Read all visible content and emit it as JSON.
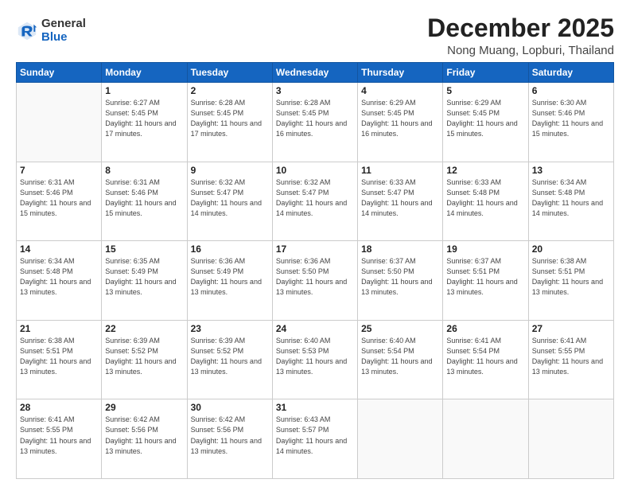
{
  "logo": {
    "general": "General",
    "blue": "Blue"
  },
  "header": {
    "month": "December 2025",
    "location": "Nong Muang, Lopburi, Thailand"
  },
  "weekdays": [
    "Sunday",
    "Monday",
    "Tuesday",
    "Wednesday",
    "Thursday",
    "Friday",
    "Saturday"
  ],
  "weeks": [
    [
      {
        "day": "",
        "sunrise": "",
        "sunset": "",
        "daylight": ""
      },
      {
        "day": "1",
        "sunrise": "Sunrise: 6:27 AM",
        "sunset": "Sunset: 5:45 PM",
        "daylight": "Daylight: 11 hours and 17 minutes."
      },
      {
        "day": "2",
        "sunrise": "Sunrise: 6:28 AM",
        "sunset": "Sunset: 5:45 PM",
        "daylight": "Daylight: 11 hours and 17 minutes."
      },
      {
        "day": "3",
        "sunrise": "Sunrise: 6:28 AM",
        "sunset": "Sunset: 5:45 PM",
        "daylight": "Daylight: 11 hours and 16 minutes."
      },
      {
        "day": "4",
        "sunrise": "Sunrise: 6:29 AM",
        "sunset": "Sunset: 5:45 PM",
        "daylight": "Daylight: 11 hours and 16 minutes."
      },
      {
        "day": "5",
        "sunrise": "Sunrise: 6:29 AM",
        "sunset": "Sunset: 5:45 PM",
        "daylight": "Daylight: 11 hours and 15 minutes."
      },
      {
        "day": "6",
        "sunrise": "Sunrise: 6:30 AM",
        "sunset": "Sunset: 5:46 PM",
        "daylight": "Daylight: 11 hours and 15 minutes."
      }
    ],
    [
      {
        "day": "7",
        "sunrise": "Sunrise: 6:31 AM",
        "sunset": "Sunset: 5:46 PM",
        "daylight": "Daylight: 11 hours and 15 minutes."
      },
      {
        "day": "8",
        "sunrise": "Sunrise: 6:31 AM",
        "sunset": "Sunset: 5:46 PM",
        "daylight": "Daylight: 11 hours and 15 minutes."
      },
      {
        "day": "9",
        "sunrise": "Sunrise: 6:32 AM",
        "sunset": "Sunset: 5:47 PM",
        "daylight": "Daylight: 11 hours and 14 minutes."
      },
      {
        "day": "10",
        "sunrise": "Sunrise: 6:32 AM",
        "sunset": "Sunset: 5:47 PM",
        "daylight": "Daylight: 11 hours and 14 minutes."
      },
      {
        "day": "11",
        "sunrise": "Sunrise: 6:33 AM",
        "sunset": "Sunset: 5:47 PM",
        "daylight": "Daylight: 11 hours and 14 minutes."
      },
      {
        "day": "12",
        "sunrise": "Sunrise: 6:33 AM",
        "sunset": "Sunset: 5:48 PM",
        "daylight": "Daylight: 11 hours and 14 minutes."
      },
      {
        "day": "13",
        "sunrise": "Sunrise: 6:34 AM",
        "sunset": "Sunset: 5:48 PM",
        "daylight": "Daylight: 11 hours and 14 minutes."
      }
    ],
    [
      {
        "day": "14",
        "sunrise": "Sunrise: 6:34 AM",
        "sunset": "Sunset: 5:48 PM",
        "daylight": "Daylight: 11 hours and 13 minutes."
      },
      {
        "day": "15",
        "sunrise": "Sunrise: 6:35 AM",
        "sunset": "Sunset: 5:49 PM",
        "daylight": "Daylight: 11 hours and 13 minutes."
      },
      {
        "day": "16",
        "sunrise": "Sunrise: 6:36 AM",
        "sunset": "Sunset: 5:49 PM",
        "daylight": "Daylight: 11 hours and 13 minutes."
      },
      {
        "day": "17",
        "sunrise": "Sunrise: 6:36 AM",
        "sunset": "Sunset: 5:50 PM",
        "daylight": "Daylight: 11 hours and 13 minutes."
      },
      {
        "day": "18",
        "sunrise": "Sunrise: 6:37 AM",
        "sunset": "Sunset: 5:50 PM",
        "daylight": "Daylight: 11 hours and 13 minutes."
      },
      {
        "day": "19",
        "sunrise": "Sunrise: 6:37 AM",
        "sunset": "Sunset: 5:51 PM",
        "daylight": "Daylight: 11 hours and 13 minutes."
      },
      {
        "day": "20",
        "sunrise": "Sunrise: 6:38 AM",
        "sunset": "Sunset: 5:51 PM",
        "daylight": "Daylight: 11 hours and 13 minutes."
      }
    ],
    [
      {
        "day": "21",
        "sunrise": "Sunrise: 6:38 AM",
        "sunset": "Sunset: 5:51 PM",
        "daylight": "Daylight: 11 hours and 13 minutes."
      },
      {
        "day": "22",
        "sunrise": "Sunrise: 6:39 AM",
        "sunset": "Sunset: 5:52 PM",
        "daylight": "Daylight: 11 hours and 13 minutes."
      },
      {
        "day": "23",
        "sunrise": "Sunrise: 6:39 AM",
        "sunset": "Sunset: 5:52 PM",
        "daylight": "Daylight: 11 hours and 13 minutes."
      },
      {
        "day": "24",
        "sunrise": "Sunrise: 6:40 AM",
        "sunset": "Sunset: 5:53 PM",
        "daylight": "Daylight: 11 hours and 13 minutes."
      },
      {
        "day": "25",
        "sunrise": "Sunrise: 6:40 AM",
        "sunset": "Sunset: 5:54 PM",
        "daylight": "Daylight: 11 hours and 13 minutes."
      },
      {
        "day": "26",
        "sunrise": "Sunrise: 6:41 AM",
        "sunset": "Sunset: 5:54 PM",
        "daylight": "Daylight: 11 hours and 13 minutes."
      },
      {
        "day": "27",
        "sunrise": "Sunrise: 6:41 AM",
        "sunset": "Sunset: 5:55 PM",
        "daylight": "Daylight: 11 hours and 13 minutes."
      }
    ],
    [
      {
        "day": "28",
        "sunrise": "Sunrise: 6:41 AM",
        "sunset": "Sunset: 5:55 PM",
        "daylight": "Daylight: 11 hours and 13 minutes."
      },
      {
        "day": "29",
        "sunrise": "Sunrise: 6:42 AM",
        "sunset": "Sunset: 5:56 PM",
        "daylight": "Daylight: 11 hours and 13 minutes."
      },
      {
        "day": "30",
        "sunrise": "Sunrise: 6:42 AM",
        "sunset": "Sunset: 5:56 PM",
        "daylight": "Daylight: 11 hours and 13 minutes."
      },
      {
        "day": "31",
        "sunrise": "Sunrise: 6:43 AM",
        "sunset": "Sunset: 5:57 PM",
        "daylight": "Daylight: 11 hours and 14 minutes."
      },
      {
        "day": "",
        "sunrise": "",
        "sunset": "",
        "daylight": ""
      },
      {
        "day": "",
        "sunrise": "",
        "sunset": "",
        "daylight": ""
      },
      {
        "day": "",
        "sunrise": "",
        "sunset": "",
        "daylight": ""
      }
    ]
  ]
}
